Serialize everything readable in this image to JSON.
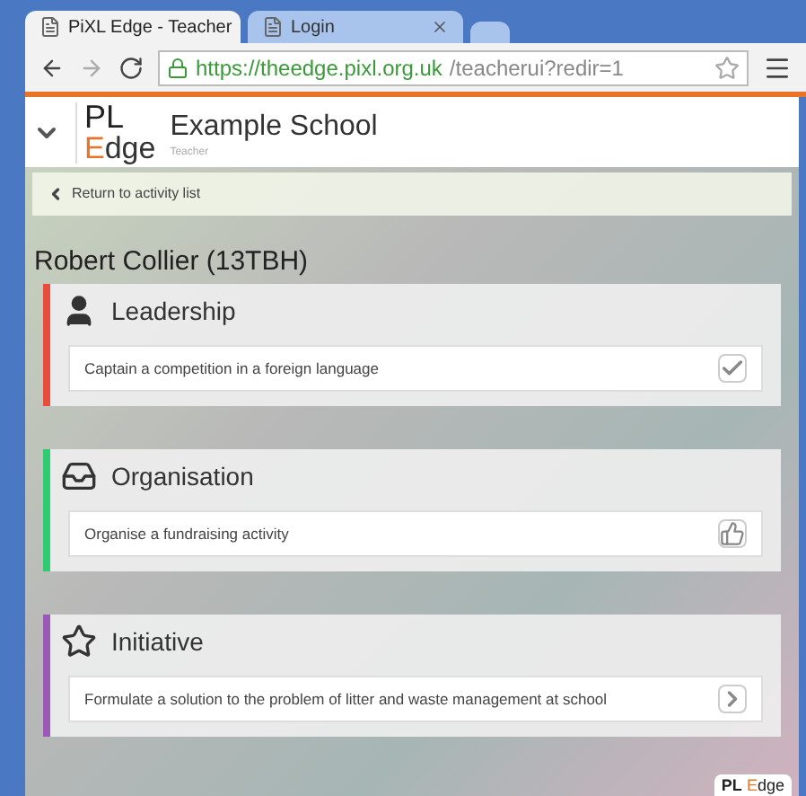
{
  "browser": {
    "tabs": [
      {
        "title": "PiXL Edge - Teacher",
        "selected": true
      },
      {
        "title": "Login",
        "selected": false
      }
    ],
    "url_host": "https://theedge.pixl.org.uk",
    "url_path": "/teacherui?redir=1"
  },
  "header": {
    "logo_top": "PL",
    "logo_bottom": "Edge",
    "school": "Example School",
    "role": "Teacher"
  },
  "back_link": "Return to activity list",
  "student": "Robert Collier (13TBH)",
  "categories": [
    {
      "title": "Leadership",
      "kind": "person",
      "color": "#e74c3c",
      "activity": {
        "text": "Captain a competition in a foreign language",
        "kind": "done"
      }
    },
    {
      "title": "Organisation",
      "kind": "inbox",
      "color": "#2ecc71",
      "activity": {
        "text": "Organise a fundraising activity",
        "kind": "like"
      }
    },
    {
      "title": "Initiative",
      "kind": "star",
      "color": "#9b59b6",
      "activity": {
        "text": "Formulate a solution to the problem of litter and waste management at school",
        "kind": "open"
      }
    }
  ],
  "footer_logo": {
    "top": "PL",
    "bottom": "Edge"
  }
}
